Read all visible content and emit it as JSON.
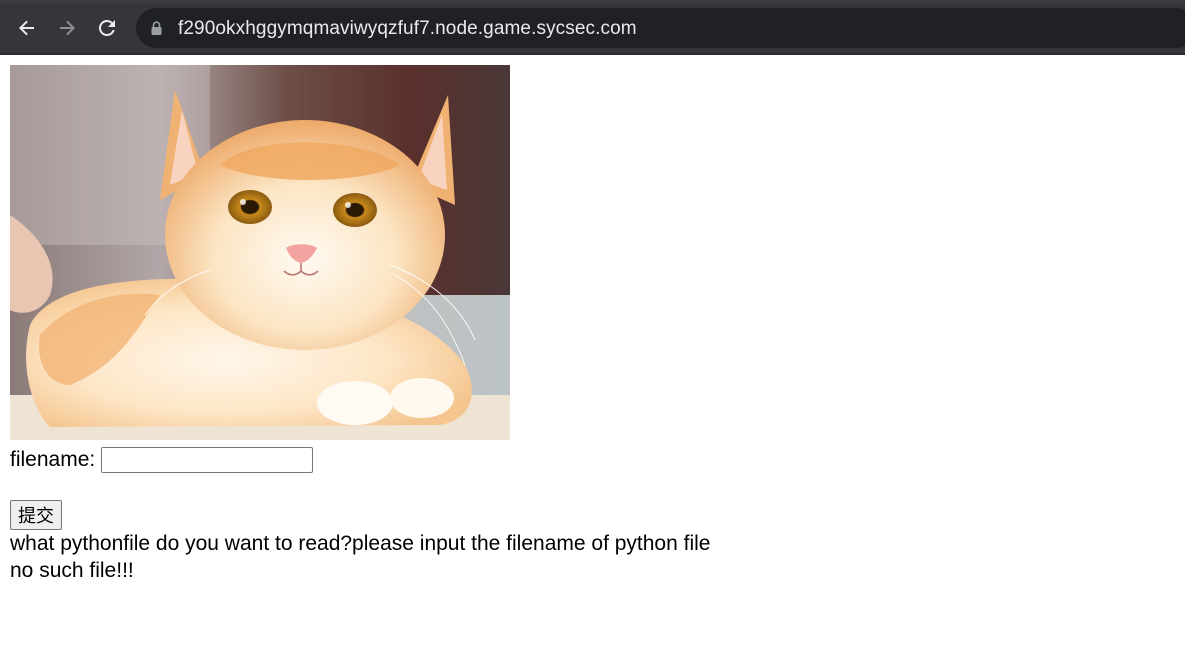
{
  "browser": {
    "url": "f290okxhggymqmaviwyqzfuf7.node.game.sycsec.com",
    "toolbar_color": "#35363a",
    "omnibox_color": "#202124",
    "icons": [
      "back-arrow-icon",
      "forward-arrow-icon",
      "reload-icon",
      "lock-icon"
    ]
  },
  "page": {
    "image": {
      "subject": "orange and white cat lying down"
    },
    "form": {
      "label": "filename:",
      "input_value": "",
      "submit_label": "提交"
    },
    "messages": {
      "prompt": "what pythonfile do you want to read?please input the filename of python file",
      "result": "no such file!!!"
    }
  }
}
